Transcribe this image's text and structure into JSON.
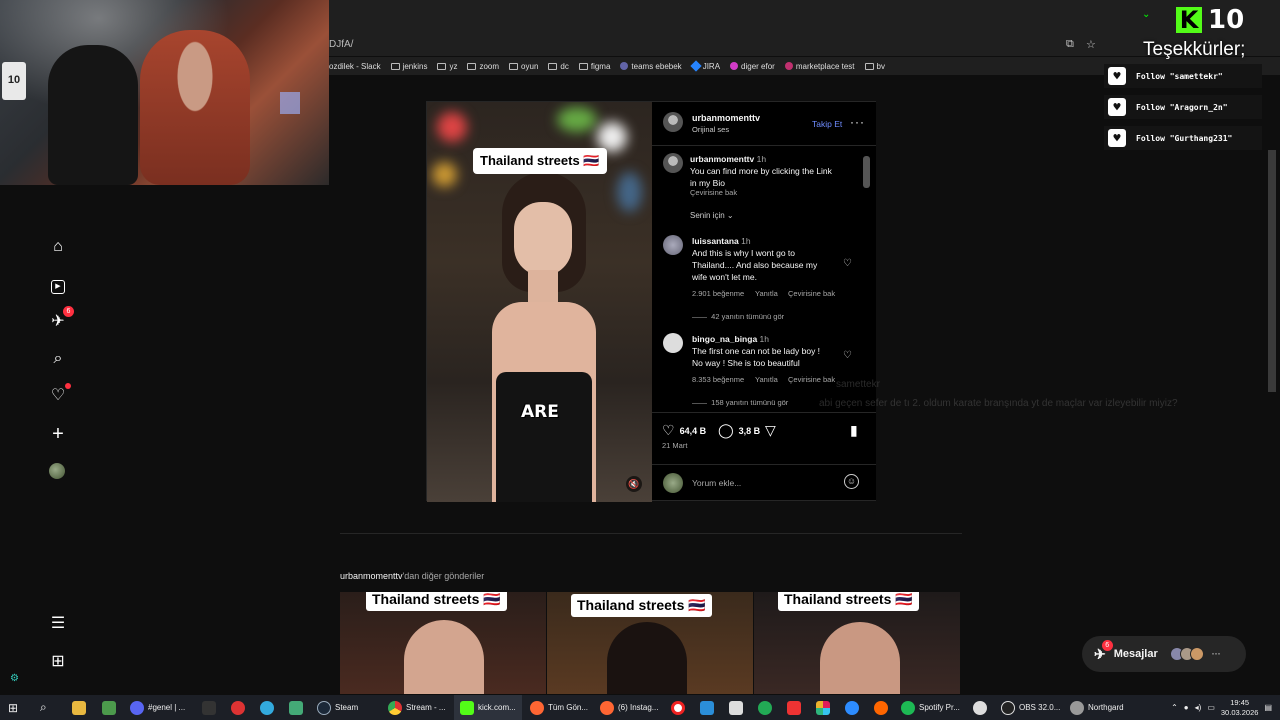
{
  "browser": {
    "url_fragment": "DJfA/",
    "bookmarks": [
      {
        "label": "ozdilek - Slack"
      },
      {
        "label": "jenkins"
      },
      {
        "label": "yz"
      },
      {
        "label": "zoom"
      },
      {
        "label": "oyun"
      },
      {
        "label": "dc"
      },
      {
        "label": "figma"
      },
      {
        "label": "teams ebebek"
      },
      {
        "label": "JIRA"
      },
      {
        "label": "diger efor"
      },
      {
        "label": "marketplace test"
      },
      {
        "label": "bv"
      }
    ]
  },
  "overlay": {
    "viewer_count": "10",
    "thanks_text": "Teşekkürler;",
    "follows": [
      {
        "text": "Follow \"samettekr\""
      },
      {
        "text": "Follow \"Aragorn_2n\""
      },
      {
        "text": "Follow \"Gurthang231\""
      }
    ],
    "webcam_shirt": "10",
    "ghost_user": "samettekr",
    "ghost_message": "abi geçen sefer de tı 2. oldum karate branşında yt de maçlar var izleyebilir miyiz?"
  },
  "sidebar": {
    "items": [
      {
        "name": "home",
        "icon": "⌂"
      },
      {
        "name": "reels",
        "icon": "▷"
      },
      {
        "name": "messages",
        "icon": "✈",
        "badge": "6"
      },
      {
        "name": "search",
        "icon": "⌕"
      },
      {
        "name": "notifications",
        "icon": "♡"
      },
      {
        "name": "create",
        "icon": "+"
      }
    ],
    "menu_icon": "☰",
    "more_icon": "⊞"
  },
  "post": {
    "username": "urbanmomenttv",
    "audio": "Orijinal ses",
    "follow_label": "Takip Et",
    "more_label": "···",
    "video_tag": "Thailand streets 🇹🇭",
    "video_word": "ARE",
    "caption": {
      "user": "urbanmomenttv",
      "time": "1h",
      "text_line1": "You can find more by clicking the Link",
      "text_line2": "in my Bio",
      "translate": "Çevirisine bak"
    },
    "sort_label": "Senin için ⌄",
    "comments": [
      {
        "user": "luissantana",
        "time": "1h",
        "lines": [
          "And this is why I wont go to",
          "Thailand.... And also because my",
          "wife won't let me."
        ],
        "likes": "2.901 beğenme",
        "reply": "Yanıtla",
        "translate": "Çevirisine bak",
        "replies": "42 yanıtın tümünü gör"
      },
      {
        "user": "bingo_na_binga",
        "time": "1h",
        "lines": [
          "The first one can not be lady boy !",
          "No way ! She is too beautiful"
        ],
        "likes": "8.353 beğenme",
        "reply": "Yanıtla",
        "translate": "Çevirisine bak",
        "replies": "158 yanıtın tümünü gör"
      }
    ],
    "like_count": "64,4 B",
    "comment_count": "3,8 B",
    "date": "21 Mart",
    "add_comment_placeholder": "Yorum ekle..."
  },
  "more_posts": {
    "title_user": "urbanmomenttv",
    "title_rest": "'dan diğer gönderiler",
    "thumbs": [
      {
        "tag": "Thailand streets 🇹🇭"
      },
      {
        "tag": "Thailand streets 🇹🇭"
      },
      {
        "tag": "Thailand streets 🇹🇭"
      }
    ]
  },
  "messages_pill": {
    "label": "Mesajlar",
    "badge": "6"
  },
  "taskbar": {
    "items": [
      {
        "label": "#genel | ..."
      },
      {
        "label": "Steam"
      },
      {
        "label": "Stream - ..."
      },
      {
        "label": "kick.com..."
      },
      {
        "label": "Tüm Gön..."
      },
      {
        "label": "(6) Instag..."
      },
      {
        "label": "Spotify Pr..."
      },
      {
        "label": "OBS 32.0..."
      },
      {
        "label": "Northgard"
      }
    ],
    "time": "19:45",
    "date": "30.03.2026"
  }
}
